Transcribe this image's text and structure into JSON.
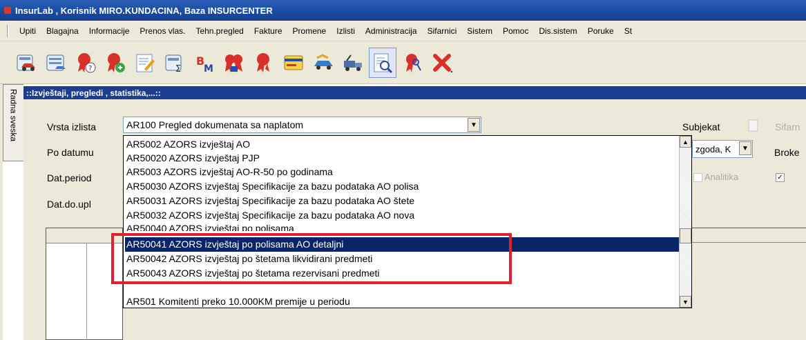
{
  "window": {
    "title": "InsurLab , Korisnik MIRO.KUNDACINA, Baza INSURCENTER"
  },
  "menu": [
    "Upiti",
    "Blagajna",
    "Informacije",
    "Prenos vlas.",
    "Tehn.pregled",
    "Fakture",
    "Promene",
    "Izlisti",
    "Administracija",
    "Sifarnici",
    "Sistem",
    "Pomoc",
    "Dis.sistem",
    "Poruke",
    "St"
  ],
  "toolbar_icons": [
    "car-report-icon",
    "car-list-icon",
    "ribbon-help-icon",
    "ribbon-add-icon",
    "edit-document-icon",
    "car-sum-icon",
    "bm-icon",
    "ribbon-group-icon",
    "ribbon-icon",
    "card-icon",
    "handshake-car-icon",
    "tow-truck-icon",
    "document-search-icon",
    "key-ribbon-icon",
    "close-icon"
  ],
  "side_tab": {
    "label": "Radna sveska"
  },
  "panel": {
    "title": "::Izvještaji, pregledi , statistika,...::"
  },
  "form": {
    "vrsta_label": "Vrsta izlista",
    "po_datumu_label": "Po datumu",
    "dat_period_label": "Dat.period",
    "dat_do_upl_label": "Dat.do.upl",
    "vrsta_value": "AR100  Pregled dokumenata sa naplatom",
    "subjekat_label": "Subjekat",
    "sifarn_label": "Sifarn",
    "zgoda_value": "zgoda, K",
    "broke_label": "Broke",
    "analitika_label": "Analitika"
  },
  "dropdown_items": [
    "AR5002  AZORS izvještaj AO",
    "AR50020 AZORS izvještaj PJP",
    "AR5003  AZORS izvještaj AO-R-50 po godinama",
    "AR50030  AZORS izvještaj Specifikacije za bazu podataka AO polisa",
    "AR50031  AZORS izvještaj Specifikacije za bazu podataka AO štete",
    "AR50032  AZORS izvještaj Specifikacije za bazu podataka AO nova",
    "AR50040  AZORS izvještaj po polisama",
    "AR50041  AZORS izvještaj po polisama AO detaljni",
    "AR50042  AZORS izvještaj po štetama likvidirani predmeti",
    "AR50043  AZORS izvještaj po štetama rezervisani predmeti",
    "",
    "AR501   Komitenti preko 10.000KM premije u periodu"
  ],
  "selected_index": 7,
  "colors": {
    "title_bar": "#1a4a9e",
    "selection": "#0a246a",
    "highlight_box": "#e0202a"
  }
}
